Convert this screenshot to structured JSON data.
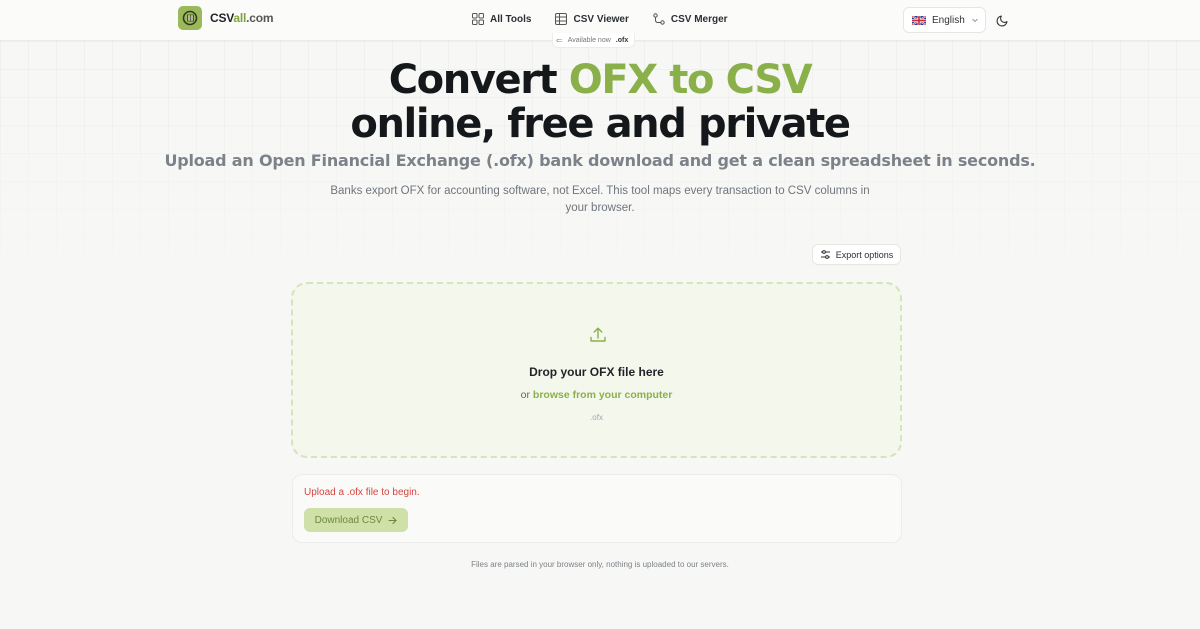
{
  "header": {
    "logo": {
      "prefix": "CSV",
      "accent": "all",
      "suffix": ".com"
    },
    "nav": [
      {
        "label": "All Tools",
        "icon": "grid-icon"
      },
      {
        "label": "CSV Viewer",
        "icon": "table-icon"
      },
      {
        "label": "CSV Merger",
        "icon": "merge-icon"
      }
    ],
    "language": {
      "label": "English",
      "flag": "uk-flag-icon"
    },
    "theme_toggle_icon": "moon-icon"
  },
  "hero": {
    "badge": {
      "text": "Available now",
      "ext": ".ofx"
    },
    "title_part1": "Convert ",
    "title_highlight": "OFX to CSV",
    "title_line2": "online, free and private",
    "subtitle": "Upload an Open Financial Exchange (.ofx) bank download and get a clean spreadsheet in seconds.",
    "description": "Banks export OFX for accounting software, not Excel. This tool maps every transaction to CSV columns in your browser."
  },
  "export_options_label": "Export options",
  "dropzone": {
    "title": "Drop your OFX file here",
    "browse_prefix": "or ",
    "browse_link": "browse from your computer",
    "accepted_ext": ".ofx"
  },
  "result_panel": {
    "message": "Upload a .ofx file to begin.",
    "download_label": "Download CSV"
  },
  "footnote": "Files are parsed in your browser only, nothing is uploaded to our servers.",
  "colors": {
    "accent": "#8ab04a",
    "error": "#d9443d",
    "disabled_button": "#cfe0a9"
  }
}
